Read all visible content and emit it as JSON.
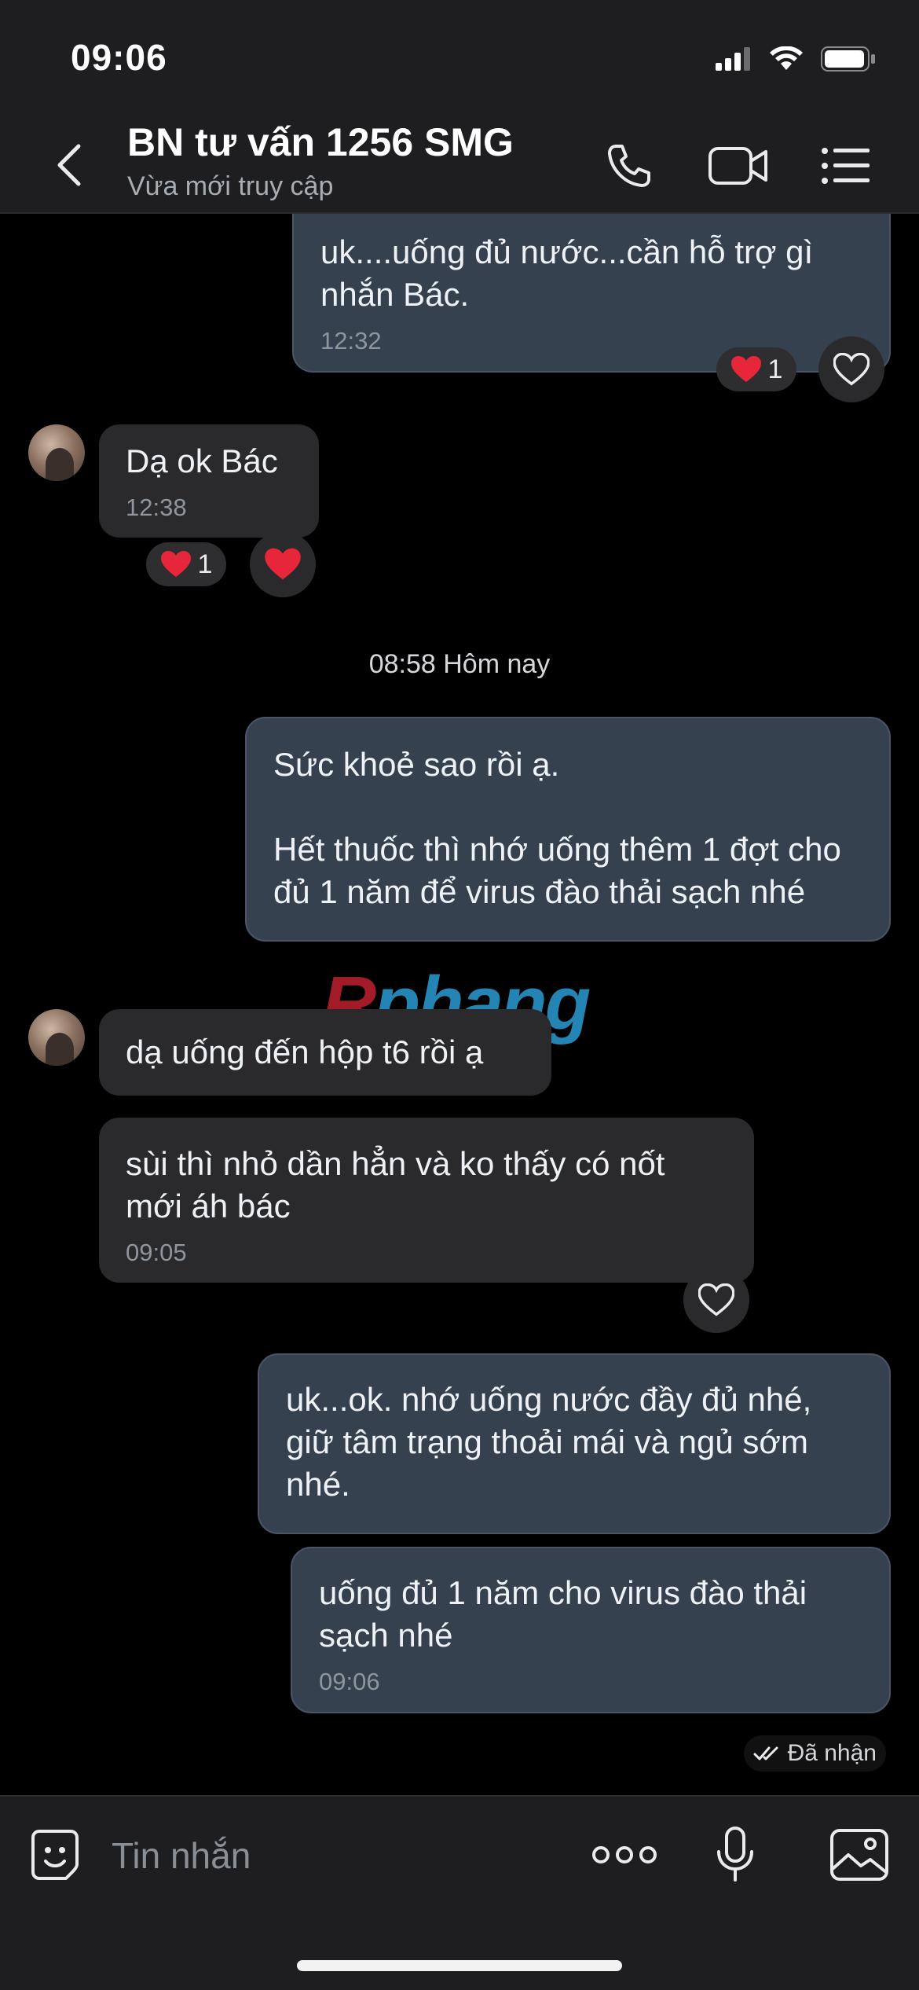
{
  "status_bar": {
    "time": "09:06"
  },
  "header": {
    "title": "BN tư vấn 1256 SMG",
    "subtitle": "Vừa mới truy cập",
    "icons": [
      "back-icon",
      "phone-icon",
      "video-call-icon",
      "menu-list-icon"
    ]
  },
  "messages": [
    {
      "direction": "out",
      "text": "uk....uống đủ nước...cần hỗ trợ gì nhắn Bác.",
      "time": "12:32",
      "reaction": {
        "emoji": "heart",
        "count": "1"
      }
    },
    {
      "direction": "in",
      "text": "Dạ ok Bác",
      "time": "12:38",
      "reaction": {
        "emoji": "heart",
        "count": "1"
      }
    },
    {
      "direction": "out",
      "text": "Sức khoẻ sao rồi ạ.\n\nHết thuốc thì nhớ uống thêm 1 đợt cho đủ 1 năm để virus đào thải sạch nhé",
      "time": ""
    },
    {
      "direction": "in",
      "text": "dạ uống đến hộp t6 rồi ạ",
      "time": ""
    },
    {
      "direction": "in",
      "text": "sùi thì nhỏ dần hẳn và ko thấy có nốt mới áh bác",
      "time": "09:05"
    },
    {
      "direction": "out",
      "text": "uk...ok. nhớ uống nước đầy đủ nhé, giữ tâm trạng thoải mái và ngủ sớm nhé.",
      "time": ""
    },
    {
      "direction": "out",
      "text": "uống đủ 1 năm cho virus đào thải sạch nhé",
      "time": "09:06"
    }
  ],
  "date_separator": "08:58 Hôm nay",
  "delivery_status": "Đã nhận",
  "watermark": {
    "part1": "R",
    "part2": "phang"
  },
  "input": {
    "placeholder": "Tin nhắn"
  },
  "colors": {
    "outgoing_bubble": "#36414f",
    "incoming_bubble": "#2a2a2c",
    "heart": "#e8263a",
    "background": "#000000"
  }
}
